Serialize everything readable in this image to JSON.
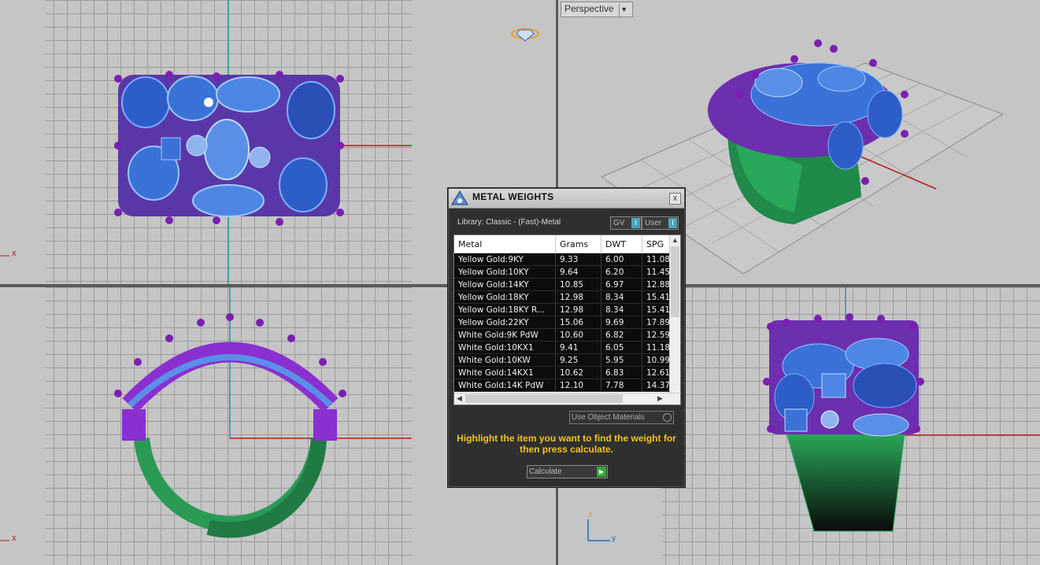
{
  "viewports": {
    "top_left_axis": "x",
    "bottom_left_axis": "x",
    "perspective_label": "Perspective",
    "gizmo_z": "z",
    "gizmo_y": "y"
  },
  "dialog": {
    "title": "METAL WEIGHTS",
    "close": "x",
    "library": "Library: Classic - (Fast)-Metal",
    "toggle_gv": "GV",
    "toggle_user": "User",
    "columns": [
      "Metal",
      "Grams",
      "DWT",
      "SPG"
    ],
    "rows": [
      [
        "Yellow Gold:9KY",
        "9.33",
        "6.00",
        "11.08"
      ],
      [
        "Yellow Gold:10KY",
        "9.64",
        "6.20",
        "11.45"
      ],
      [
        "Yellow Gold:14KY",
        "10.85",
        "6.97",
        "12.88"
      ],
      [
        "Yellow Gold:18KY",
        "12.98",
        "8.34",
        "15.41"
      ],
      [
        "Yellow Gold:18KY R...",
        "12.98",
        "8.34",
        "15.41"
      ],
      [
        "Yellow Gold:22KY",
        "15.06",
        "9.69",
        "17.89"
      ],
      [
        "White Gold:9K PdW",
        "10.60",
        "6.82",
        "12.59"
      ],
      [
        "White Gold:10KX1",
        "9.41",
        "6.05",
        "11.18"
      ],
      [
        "White Gold:10KW",
        "9.25",
        "5.95",
        "10.99"
      ],
      [
        "White Gold:14KX1",
        "10.62",
        "6.83",
        "12.61"
      ],
      [
        "White Gold:14K PdW",
        "12.10",
        "7.78",
        "14.37"
      ]
    ],
    "use_object_materials": "Use Object Materials",
    "hint": "Highlight the item you want to find the weight for then press calculate.",
    "calculate": "Calculate"
  }
}
